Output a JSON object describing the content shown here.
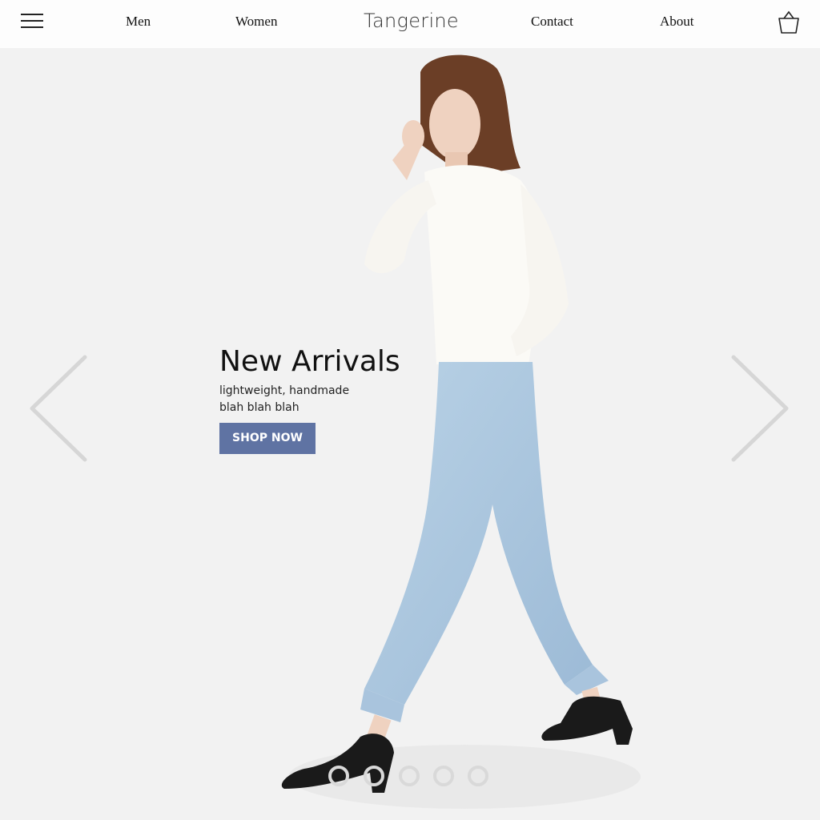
{
  "header": {
    "brand": "Tangerine",
    "nav": [
      "Men",
      "Women",
      "Contact",
      "About"
    ],
    "menu_icon": "hamburger-icon",
    "cart_icon": "shopping-basket-icon"
  },
  "hero": {
    "headline": "New Arrivals",
    "subline_1": "lightweight, handmade",
    "subline_2": "blah blah blah",
    "cta": "SHOP NOW",
    "cta_color": "#5f73a3",
    "prev_icon": "chevron-left-icon",
    "next_icon": "chevron-right-icon",
    "slide_count": 5
  }
}
